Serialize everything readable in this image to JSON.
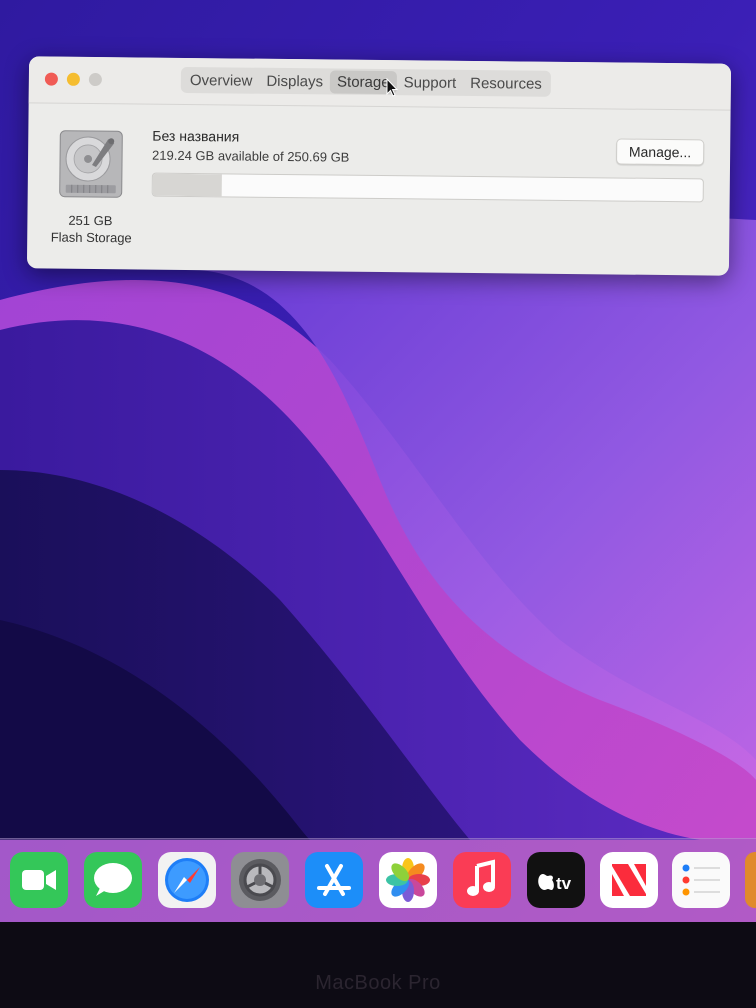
{
  "window": {
    "tabs": [
      {
        "label": "Overview"
      },
      {
        "label": "Displays"
      },
      {
        "label": "Storage"
      },
      {
        "label": "Support"
      },
      {
        "label": "Resources"
      }
    ],
    "active_tab": "Storage",
    "disk": {
      "size": "251 GB",
      "type": "Flash Storage",
      "volume_name": "Без названия",
      "available": "219.24 GB available of 250.69 GB",
      "used_fraction": 0.125
    },
    "manage_label": "Manage..."
  },
  "dock": {
    "apps": [
      "FaceTime",
      "Messages",
      "Safari",
      "System Preferences",
      "App Store",
      "Photos",
      "Music",
      "Apple TV",
      "News",
      "Reminders"
    ]
  },
  "bezel": {
    "label": "MacBook Pro"
  },
  "colors": {
    "close": "#f05b55",
    "minimize": "#f5bd30",
    "zoom_disabled": "#cdcbc8"
  }
}
